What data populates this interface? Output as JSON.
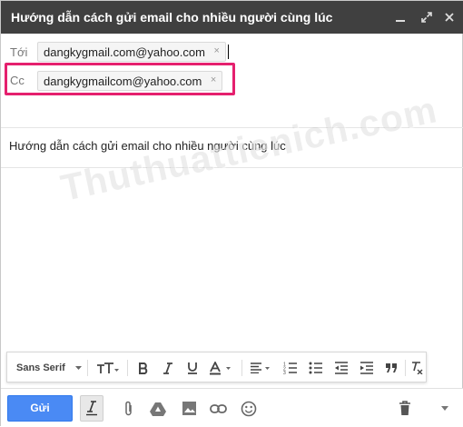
{
  "window": {
    "title": "Hướng dẫn cách gửi email cho nhiều người cùng lúc"
  },
  "recipients": {
    "to_label": "Tới",
    "to_chip": "dangkygmail.com@yahoo.com",
    "cc_label": "Cc",
    "cc_chip": "dangkygmailcom@yahoo.com",
    "remove_glyph": "×"
  },
  "subject": "Hướng dẫn cách gửi email cho nhiều người cùng lúc",
  "body": {
    "watermark": "Thuthuattienich.com"
  },
  "format_toolbar": {
    "font": "Sans Serif",
    "buttons": [
      "font-size-icon",
      "bold-icon",
      "italic-icon",
      "underline-icon",
      "text-color-icon",
      "align-icon",
      "numbered-list-icon",
      "bulleted-list-icon",
      "indent-less-icon",
      "indent-more-icon",
      "quote-icon",
      "remove-formatting-icon"
    ]
  },
  "bottom_toolbar": {
    "send_label": "Gửi",
    "buttons": [
      "formatting-toggle-icon",
      "attach-icon",
      "drive-icon",
      "photo-icon",
      "link-icon",
      "emoji-icon",
      "trash-icon",
      "more-options-icon"
    ]
  },
  "colors": {
    "titlebar": "#404040",
    "send_button": "#4a8af4",
    "highlight_border": "#e5206e"
  }
}
